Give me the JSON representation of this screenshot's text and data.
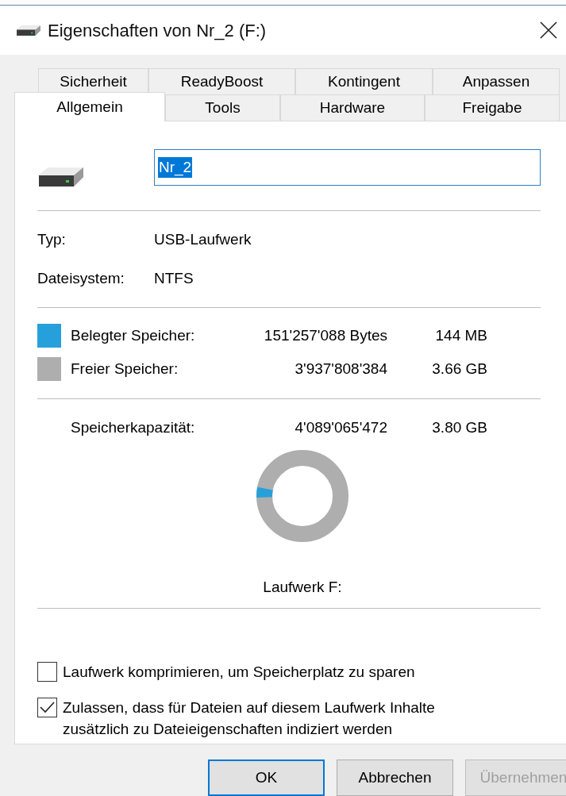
{
  "window": {
    "title": "Eigenschaften von Nr_2 (F:)"
  },
  "tabs_back": [
    {
      "label": "Sicherheit",
      "selected": false
    },
    {
      "label": "ReadyBoost",
      "selected": false
    },
    {
      "label": "Kontingent",
      "selected": false
    },
    {
      "label": "Anpassen",
      "selected": false
    }
  ],
  "tabs_front": [
    {
      "label": "Allgemein",
      "selected": true
    },
    {
      "label": "Tools",
      "selected": false
    },
    {
      "label": "Hardware",
      "selected": false
    },
    {
      "label": "Freigabe",
      "selected": false
    }
  ],
  "name_field": {
    "value": "Nr_2"
  },
  "info": [
    {
      "label": "Typ:",
      "value": "USB-Laufwerk"
    },
    {
      "label": "Dateisystem:",
      "value": "NTFS"
    }
  ],
  "space": [
    {
      "label": "Belegter Speicher:",
      "bytes": "151'257'088 Bytes",
      "size": "144 MB",
      "color": "#26a0da"
    },
    {
      "label": "Freier Speicher:",
      "bytes": "3'937'808'384",
      "size": "3.66 GB",
      "color": "#aeaeae"
    }
  ],
  "capacity": {
    "label": "Speicherkapazität:",
    "bytes": "4'089'065'472",
    "size": "3.80 GB"
  },
  "usage_ring": {
    "caption": "Laufwerk F:"
  },
  "options": [
    {
      "label": "Laufwerk komprimieren, um Speicherplatz zu sparen",
      "checked": false
    },
    {
      "label": "Zulassen, dass für Dateien auf diesem Laufwerk Inhalte zusätzlich zu Dateieigenschaften indiziert werden",
      "checked": true
    }
  ],
  "buttons": [
    {
      "label": "OK",
      "kind": "default",
      "disabled": false
    },
    {
      "label": "Abbrechen",
      "kind": "normal",
      "disabled": false
    },
    {
      "label": "Übernehmen",
      "kind": "normal",
      "disabled": true
    }
  ]
}
